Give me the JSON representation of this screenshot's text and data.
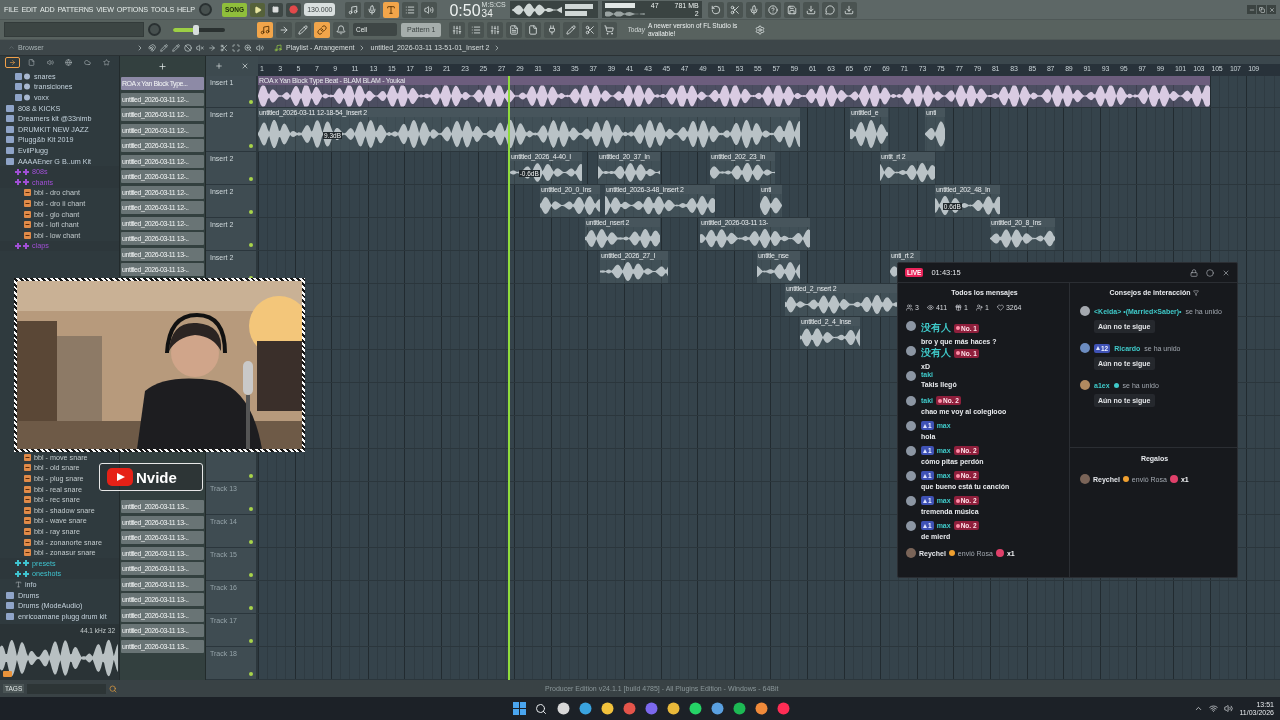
{
  "menu": [
    "FILE",
    "EDIT",
    "ADD",
    "PATTERNS",
    "VIEW",
    "OPTIONS",
    "TOOLS",
    "HELP"
  ],
  "transport": {
    "mode": "SONG",
    "tempo": "130.000",
    "time": "0:50",
    "time_fraction": "34",
    "time_unit": "M:S:CS",
    "cpu": "47",
    "memory": "781 MB",
    "polyphony": "2",
    "master_volume": {
      "level": 0.45
    }
  },
  "toolbar": {
    "row1_buttons": [
      {
        "on": false
      },
      {
        "on": false
      },
      {
        "on": true
      },
      {
        "on": false
      },
      {
        "on": false
      }
    ],
    "row2_buttons": [
      {
        "on": true
      },
      {
        "on": false
      },
      {
        "on": false
      },
      {
        "on": true
      },
      {
        "on": false
      }
    ],
    "snap": "Cell",
    "pattern": "Pattern 1",
    "news_date": "Today",
    "news": "A newer version of FL Studio is available!"
  },
  "browser": {
    "title": "Browser",
    "tabs": [
      {
        "selected": true
      },
      {
        "selected": false
      },
      {
        "selected": false
      },
      {
        "selected": false
      },
      {
        "selected": false
      },
      {
        "selected": false
      }
    ],
    "tree_top": [
      {
        "children": [
          {
            "kind": "folder",
            "label": "snares"
          },
          {
            "kind": "folder",
            "label": "transiciones"
          },
          {
            "kind": "folder",
            "label": "voxx"
          }
        ]
      },
      {
        "kind": "pack",
        "label": "808 & KICKS"
      },
      {
        "kind": "pack",
        "label": "Dreamers kit @33nimb"
      },
      {
        "kind": "pack",
        "label": "DRUMKIT NEW JAZZ"
      },
      {
        "kind": "pack",
        "label": "Plugg&b Kit 2019"
      },
      {
        "kind": "pack",
        "label": "EvilPlugg"
      },
      {
        "kind": "pack",
        "label": "AAAAEner G B..um Kit",
        "children": [
          {
            "kind": "category",
            "label": "808s",
            "color": "#a14fd6"
          },
          {
            "kind": "category",
            "label": "chants",
            "color": "#a14fd6",
            "children": [
              {
                "kind": "sample",
                "label": "bbl - dro chant"
              },
              {
                "kind": "sample",
                "label": "bbl - dro ii chant"
              },
              {
                "kind": "sample",
                "label": "bbl - glo chant"
              },
              {
                "kind": "sample",
                "label": "bbl - lofi chant"
              },
              {
                "kind": "sample",
                "label": "bbl - low chant"
              }
            ]
          },
          {
            "kind": "category",
            "label": "claps",
            "color": "#a14fd6"
          }
        ]
      }
    ],
    "tree_bottom": [
      {
        "children": [
          {
            "children": [
              {
                "kind": "sample",
                "label": "bbl - move snare"
              },
              {
                "kind": "sample",
                "label": "bbl - old snare"
              },
              {
                "kind": "sample",
                "label": "bbl - plug snare"
              },
              {
                "kind": "sample",
                "label": "bbl - real snare"
              },
              {
                "kind": "sample",
                "label": "bbl - rec snare"
              },
              {
                "kind": "sample",
                "label": "bbl - shadow snare"
              },
              {
                "kind": "sample",
                "label": "bbl - wave snare"
              },
              {
                "kind": "sample",
                "label": "bbl - ray snare"
              },
              {
                "kind": "sample",
                "label": "bbl - zonanorte snare"
              },
              {
                "kind": "sample",
                "label": "bbl - zonasur snare"
              }
            ]
          },
          {
            "kind": "category",
            "label": "presets",
            "color": "#3fc3cf"
          },
          {
            "kind": "category",
            "label": "oneshots",
            "color": "#3fc3cf"
          },
          {
            "kind": "info",
            "label": "info"
          }
        ]
      },
      {
        "kind": "pack",
        "label": "Drums"
      },
      {
        "kind": "pack",
        "label": "Drums (ModeAudio)"
      },
      {
        "kind": "pack",
        "label": "enricoamane plugg drum kit"
      }
    ],
    "preview_info": "44.1 kHz 32",
    "tags_label": "TAGS"
  },
  "playlist": {
    "title": "Playlist - Arrangement",
    "path": "untitled_2026-03-11 13-51-01_Insert 2",
    "ruler": [
      "1",
      "3",
      "5",
      "7",
      "9",
      "11",
      "13",
      "15",
      "17",
      "19",
      "21",
      "23",
      "25",
      "27",
      "29",
      "31",
      "33",
      "35",
      "37",
      "39",
      "41",
      "43",
      "45",
      "47",
      "49",
      "51",
      "53",
      "55",
      "57",
      "59",
      "61",
      "63",
      "65",
      "67",
      "69",
      "71",
      "73",
      "75",
      "77",
      "79",
      "81",
      "83",
      "85",
      "87",
      "89",
      "91",
      "93",
      "95",
      "97",
      "99",
      "101",
      "103",
      "105",
      "107",
      "109"
    ],
    "clip_list_top": [
      {
        "label": "ROA x Yan Block Type...",
        "selected": true
      },
      {
        "label": "untitled_2026-03-11 12-..",
        "selected": false
      },
      {
        "label": "untitled_2026-03-11 12-..",
        "selected": false
      },
      {
        "label": "untitled_2026-03-11 12-..",
        "selected": false
      },
      {
        "label": "untitled_2026-03-11 12-..",
        "selected": false
      },
      {
        "label": "untitled_2026-03-11 12-..",
        "selected": false
      },
      {
        "label": "untitled_2026-03-11 12-..",
        "selected": false
      },
      {
        "label": "untitled_2026-03-11 12-..",
        "selected": false
      },
      {
        "label": "untitled_2026-03-11 12-..",
        "selected": false
      },
      {
        "label": "untitled_2026-03-11 12-..",
        "selected": false
      },
      {
        "label": "untitled_2026-03-11 13-..",
        "selected": false
      },
      {
        "label": "untitled_2026-03-11 13-..",
        "selected": false
      },
      {
        "label": "untitled_2026-03-11 13-..",
        "selected": false
      }
    ],
    "clip_list_bottom": [
      {
        "label": "untitled_2026-03-11 13-..",
        "selected": false
      },
      {
        "label": "untitled_2026-03-11 13-..",
        "selected": false
      },
      {
        "label": "untitled_2026-03-11 13-..",
        "selected": false
      },
      {
        "label": "untitled_2026-03-11 13-..",
        "selected": false
      },
      {
        "label": "untitled_2026-03-11 13-..",
        "selected": false
      },
      {
        "label": "untitled_2026-03-11 13-..",
        "selected": false
      },
      {
        "label": "untitled_2026-03-11 13-..",
        "selected": false
      },
      {
        "label": "untitled_2026-03-11 13-..",
        "selected": false
      },
      {
        "label": "untitled_2026-03-11 13-..",
        "selected": false
      },
      {
        "label": "untitled_2026-03-11 13-..",
        "selected": false
      }
    ],
    "tracks": [
      {
        "label": "Insert 1",
        "clips": [
          {
            "label": "ROA x Yan Block Type Beat - BLAM BLAM - Youkai"
          }
        ]
      },
      {
        "label": "Insert 2",
        "clips": [
          {
            "label": "untitled_2026-03-11 12-18-54_Insert 2",
            "gain": "9.3dB"
          },
          {
            "label": "untitled_e"
          },
          {
            "label": "unti"
          }
        ]
      },
      {
        "label": "Insert 2",
        "clips": [
          {
            "label": "untitled_2026_4-40_I",
            "gain": "-0.6dB"
          },
          {
            "label": "untitled_20_37_In"
          },
          {
            "label": "untitled_202_23_In"
          },
          {
            "label": "untit_rt 2"
          }
        ]
      },
      {
        "label": "Insert 2",
        "clips": [
          {
            "label": "untitled_20_0_Ins"
          },
          {
            "label": "untitled_2026-3-48_Insert 2"
          },
          {
            "label": "unti"
          },
          {
            "label": "untitled_202_48_In",
            "gain": "0.6dB"
          }
        ]
      },
      {
        "label": "Insert 2",
        "clips": [
          {
            "label": "untitled_nsert 2"
          },
          {
            "label": "untitled_2026-03-11 13-"
          },
          {
            "label": "untitled_20_8_Ins"
          }
        ]
      },
      {
        "label": "Insert 2",
        "clips": [
          {
            "label": "untitled_2026_27_I"
          },
          {
            "label": "untitle_nse"
          },
          {
            "label": "unti_rt 2"
          }
        ]
      },
      {
        "clips": [
          {
            "label": "untitled_2_nsert 2"
          }
        ]
      },
      {
        "clips": [
          {
            "label": "untitled_2_4_Inse"
          }
        ]
      }
    ],
    "tracks_bottom": [
      {
        "label": "Track 13"
      },
      {
        "label": "Track 14"
      },
      {
        "label": "Track 15"
      },
      {
        "label": "Track 16"
      },
      {
        "label": "Track 17"
      },
      {
        "label": "Track 18"
      }
    ]
  },
  "channel_badge": {
    "name": "Nvide"
  },
  "live_chat": {
    "live_label": "LIVE",
    "duration": "01:43:15",
    "messages_title": "Todos los mensajes",
    "stats": [
      {
        "kind": "users",
        "value": "3"
      },
      {
        "kind": "views",
        "value": "411"
      },
      {
        "kind": "gifts",
        "value": "1"
      },
      {
        "kind": "follows",
        "value": "1"
      },
      {
        "kind": "likes",
        "value": "3264"
      }
    ],
    "messages": [
      {
        "kind": "chat",
        "user": "没有人",
        "rank": "No. 1",
        "text": "bro y que más haces ?"
      },
      {
        "kind": "chat",
        "user": "没有人",
        "rank": "No. 1",
        "text": "xD"
      },
      {
        "kind": "chat",
        "user": "taki",
        "text": "Takis llegó"
      },
      {
        "kind": "chat",
        "user": "taki",
        "rank": "No. 2",
        "text": "chao me voy al colegiooo"
      },
      {
        "kind": "chat",
        "fan_level": "1",
        "user": "max",
        "text": "hola"
      },
      {
        "kind": "chat",
        "fan_level": "1",
        "user": "max",
        "rank": "No. 2",
        "text": "cómo pitas perdón"
      },
      {
        "kind": "chat",
        "fan_level": "1",
        "user": "max",
        "rank": "No. 2",
        "text": "que bueno está tu canción"
      },
      {
        "kind": "chat",
        "fan_level": "1",
        "user": "max",
        "rank": "No. 2",
        "text": "tremenda música"
      },
      {
        "kind": "chat",
        "fan_level": "1",
        "user": "max",
        "rank": "No. 2",
        "text": "de mierd"
      },
      {
        "kind": "gift",
        "user": "Reychel",
        "text": "envió Rosa",
        "count": "x1"
      }
    ],
    "tips_title": "Consejos de interacción",
    "joins": [
      {
        "user": "<Kelda> •(Married×Saber)•",
        "verified": false,
        "action": "se ha unido",
        "button": "Aún no te sigue"
      },
      {
        "fan_level": "12",
        "user": "Ricardo",
        "verified": false,
        "action": "se ha unido",
        "button": "Aún no te sigue"
      },
      {
        "user": "a1ex",
        "verified": true,
        "action": "se ha unido",
        "button": "Aún no te sigue"
      }
    ],
    "gifts_title": "Regalos",
    "gifts": [
      {
        "user": "Reychel",
        "text": "envió Rosa",
        "count": "x1"
      }
    ]
  },
  "status_bar": "Producer Edition v24.1.1 [build 4785] - All Plugins Edition - Windows - 64Bit",
  "taskbar": {
    "time": "13:51",
    "date": "11/03/2026"
  }
}
